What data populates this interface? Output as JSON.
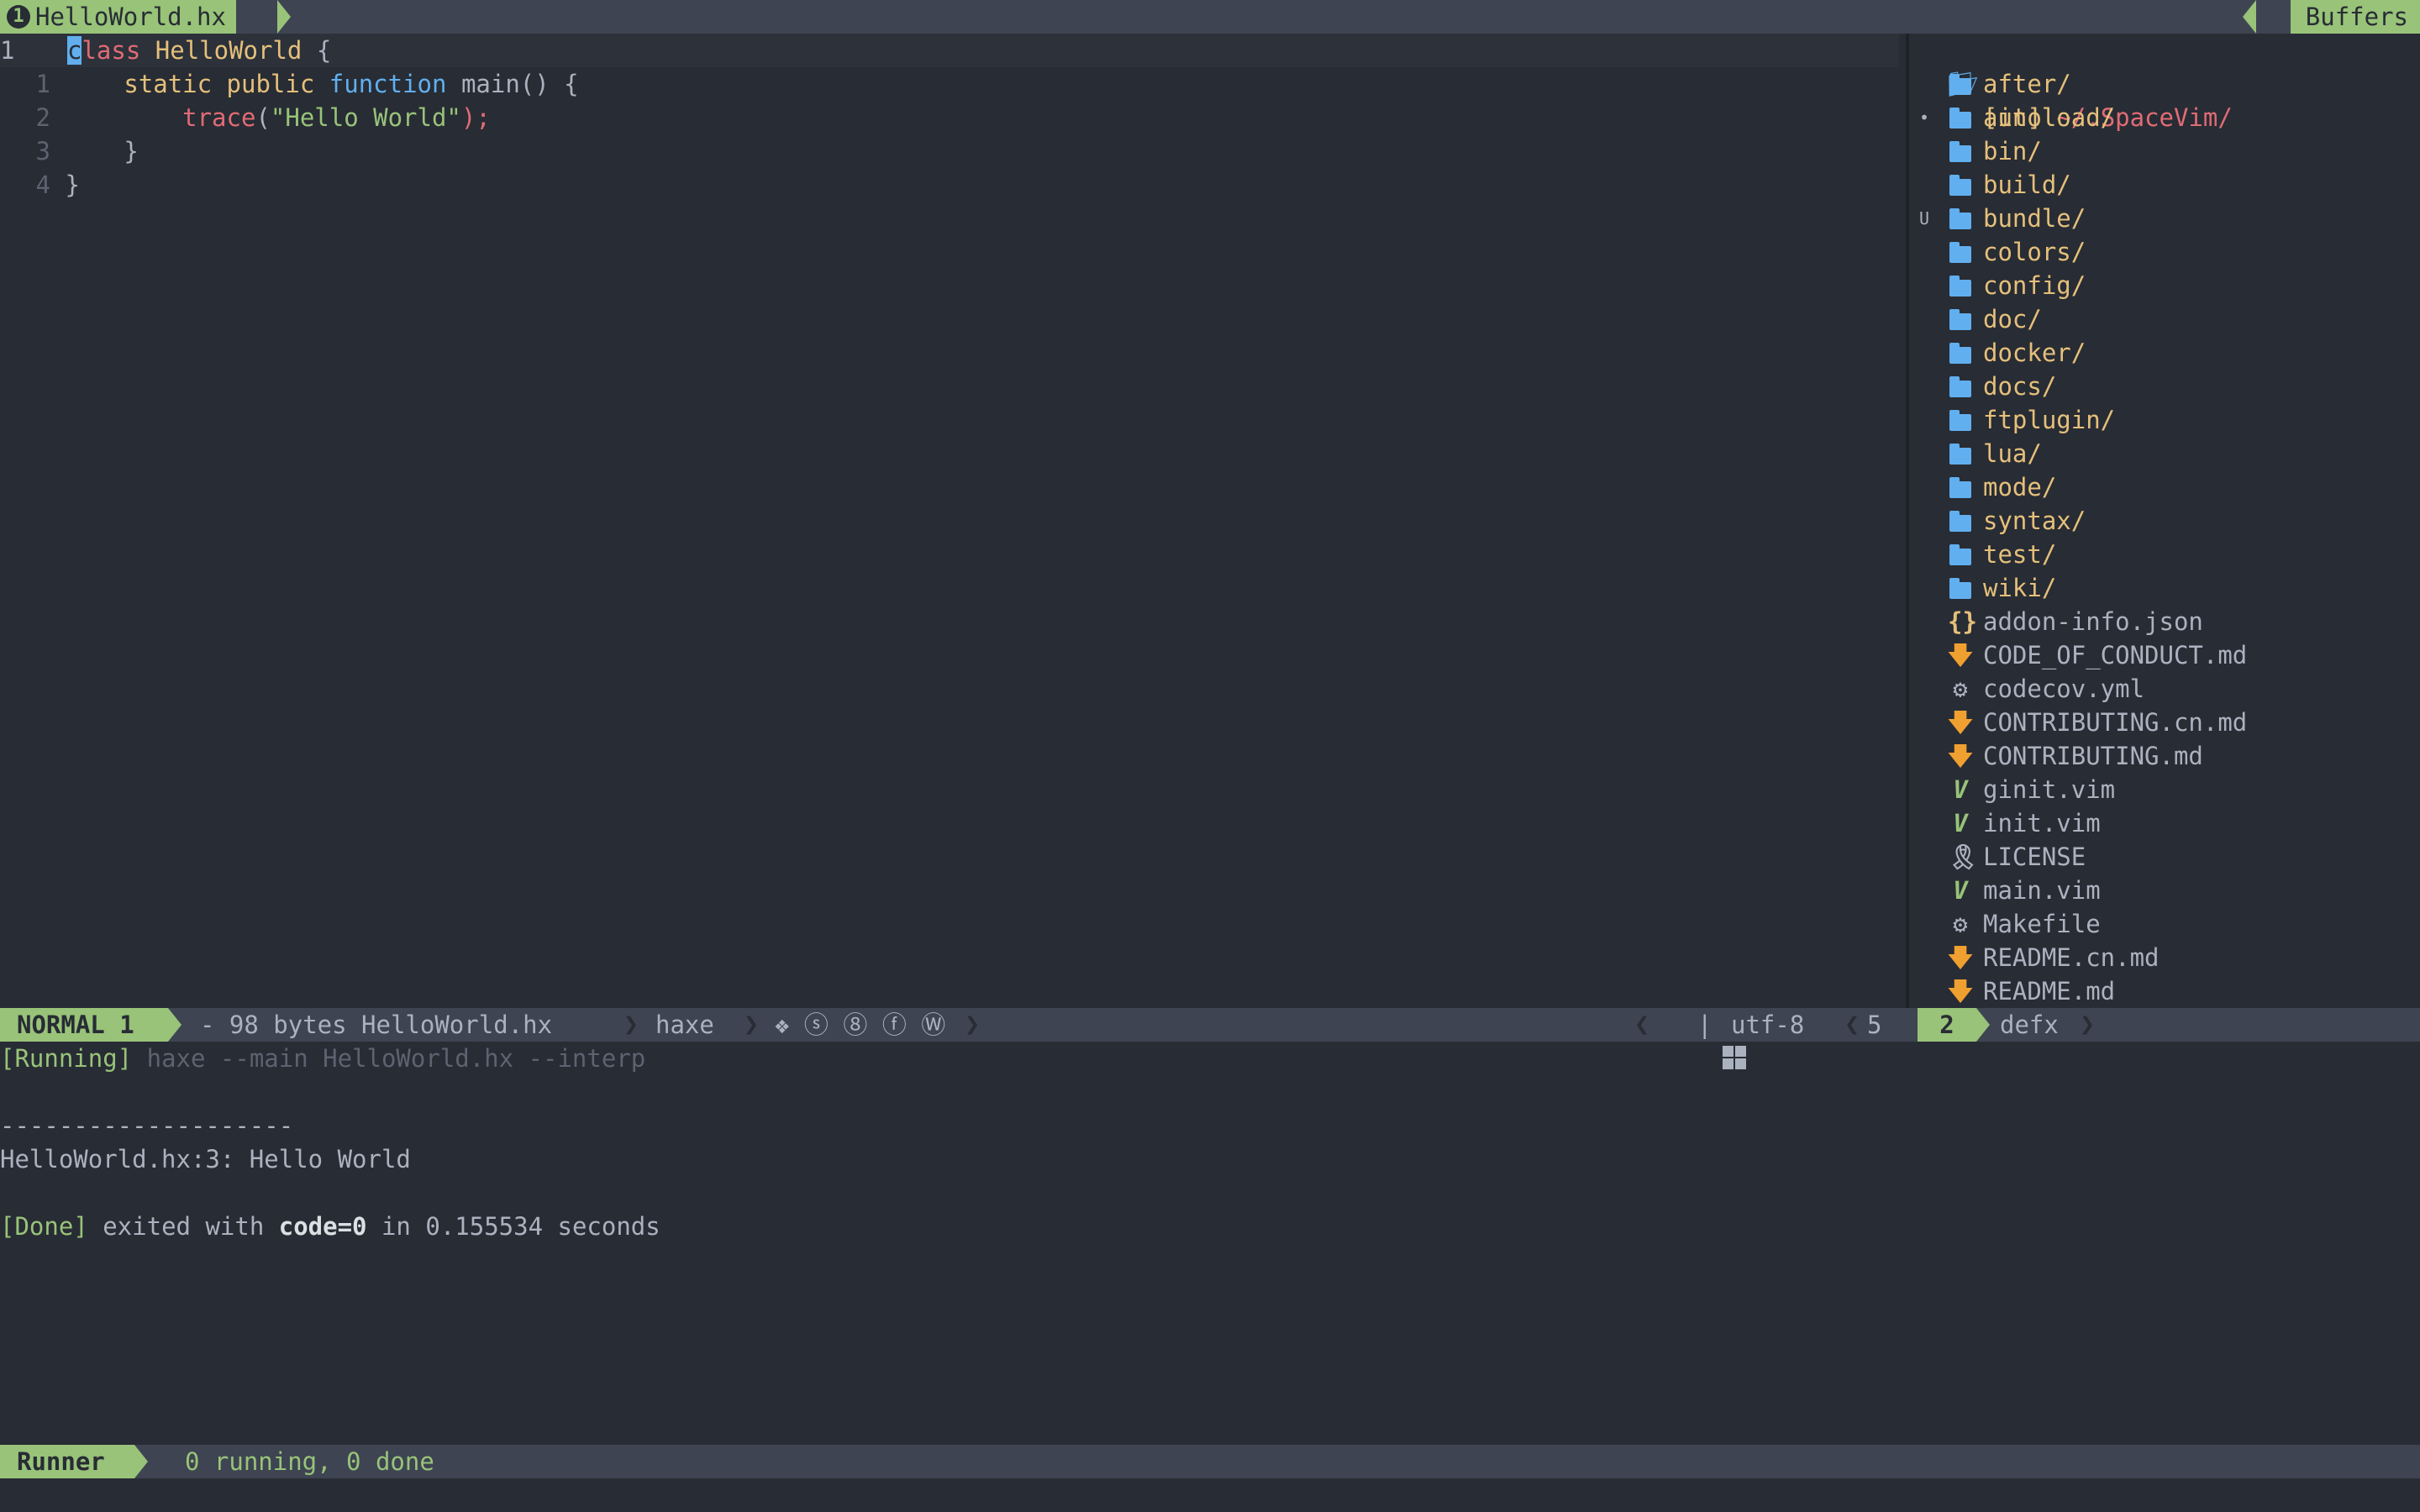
{
  "tabline": {
    "tab_number": "1",
    "tab_title": "HelloWorld.hx",
    "buffers_label": "Buffers"
  },
  "editor": {
    "current_line_number": "1",
    "line_numbers": [
      "1",
      "2",
      "3",
      "4"
    ],
    "code": {
      "l0_kw": "class",
      "l0_name": "HelloWorld",
      "l0_rest": " {",
      "l1_static": "static",
      "l1_public": "public",
      "l1_function": "function",
      "l1_main": "main() {",
      "l2_trace": "trace",
      "l2_open": "(",
      "l2_string": "\"Hello World\"",
      "l2_close": ");",
      "l3": "}",
      "l4": "}"
    }
  },
  "file_tree": {
    "root_prefix": "[in]",
    "root_path": "~/.SpaceVim/",
    "items": [
      {
        "name": "after/",
        "type": "dir",
        "icon": "folder-icon",
        "mark": ""
      },
      {
        "name": "autoload/",
        "type": "dir",
        "icon": "folder-icon",
        "mark": "•"
      },
      {
        "name": "bin/",
        "type": "dir",
        "icon": "folder-icon",
        "mark": ""
      },
      {
        "name": "build/",
        "type": "dir",
        "icon": "folder-icon",
        "mark": ""
      },
      {
        "name": "bundle/",
        "type": "dir",
        "icon": "folder-icon",
        "mark": "U"
      },
      {
        "name": "colors/",
        "type": "dir",
        "icon": "folder-icon",
        "mark": ""
      },
      {
        "name": "config/",
        "type": "dir",
        "icon": "folder-icon",
        "mark": ""
      },
      {
        "name": "doc/",
        "type": "dir",
        "icon": "folder-icon",
        "mark": ""
      },
      {
        "name": "docker/",
        "type": "dir",
        "icon": "folder-icon",
        "mark": ""
      },
      {
        "name": "docs/",
        "type": "dir",
        "icon": "folder-icon",
        "mark": ""
      },
      {
        "name": "ftplugin/",
        "type": "dir",
        "icon": "folder-icon",
        "mark": ""
      },
      {
        "name": "lua/",
        "type": "dir",
        "icon": "folder-icon",
        "mark": ""
      },
      {
        "name": "mode/",
        "type": "dir",
        "icon": "folder-icon",
        "mark": ""
      },
      {
        "name": "syntax/",
        "type": "dir",
        "icon": "folder-icon",
        "mark": ""
      },
      {
        "name": "test/",
        "type": "dir",
        "icon": "folder-icon",
        "mark": ""
      },
      {
        "name": "wiki/",
        "type": "dir",
        "icon": "folder-icon",
        "mark": ""
      },
      {
        "name": "addon-info.json",
        "type": "file",
        "icon": "json-icon",
        "mark": ""
      },
      {
        "name": "CODE_OF_CONDUCT.md",
        "type": "file",
        "icon": "markdown-icon",
        "mark": ""
      },
      {
        "name": "codecov.yml",
        "type": "file",
        "icon": "gear-icon",
        "mark": ""
      },
      {
        "name": "CONTRIBUTING.cn.md",
        "type": "file",
        "icon": "markdown-icon",
        "mark": ""
      },
      {
        "name": "CONTRIBUTING.md",
        "type": "file",
        "icon": "markdown-icon",
        "mark": ""
      },
      {
        "name": "ginit.vim",
        "type": "file",
        "icon": "vim-icon",
        "mark": ""
      },
      {
        "name": "init.vim",
        "type": "file",
        "icon": "vim-icon",
        "mark": ""
      },
      {
        "name": "LICENSE",
        "type": "file",
        "icon": "license-icon",
        "mark": ""
      },
      {
        "name": "main.vim",
        "type": "file",
        "icon": "vim-icon",
        "mark": ""
      },
      {
        "name": "Makefile",
        "type": "file",
        "icon": "gear-icon",
        "mark": ""
      },
      {
        "name": "README.cn.md",
        "type": "file",
        "icon": "markdown-icon",
        "mark": ""
      },
      {
        "name": "README.md",
        "type": "file",
        "icon": "markdown-icon",
        "mark": ""
      }
    ]
  },
  "statusline": {
    "mode": "NORMAL 1",
    "file_info": "- 98 bytes HelloWorld.hx",
    "filetype": "haxe",
    "flags": "❖ ⓢ ⑧ ⓕ Ⓦ",
    "os_sep": "|",
    "encoding": "utf-8",
    "line": "5",
    "tree_num": "2",
    "tree_name": "defx"
  },
  "runner": {
    "running_tag": "[Running]",
    "command": "haxe --main HelloWorld.hx --interp",
    "separator": "--------------------",
    "output": "HelloWorld.hx:3: Hello World",
    "done_tag": "[Done]",
    "done_pre": " exited with ",
    "done_code": "code=0",
    "done_post": " in 0.155534 seconds"
  },
  "runner_status": {
    "label": "Runner",
    "summary": "0 running, 0 done"
  },
  "colors": {
    "background": "#282c34",
    "accent_green": "#98c379",
    "folder_blue": "#61afef",
    "dir_yellow": "#e5c07b",
    "red": "#e06c75",
    "md_orange": "#f0a030"
  }
}
